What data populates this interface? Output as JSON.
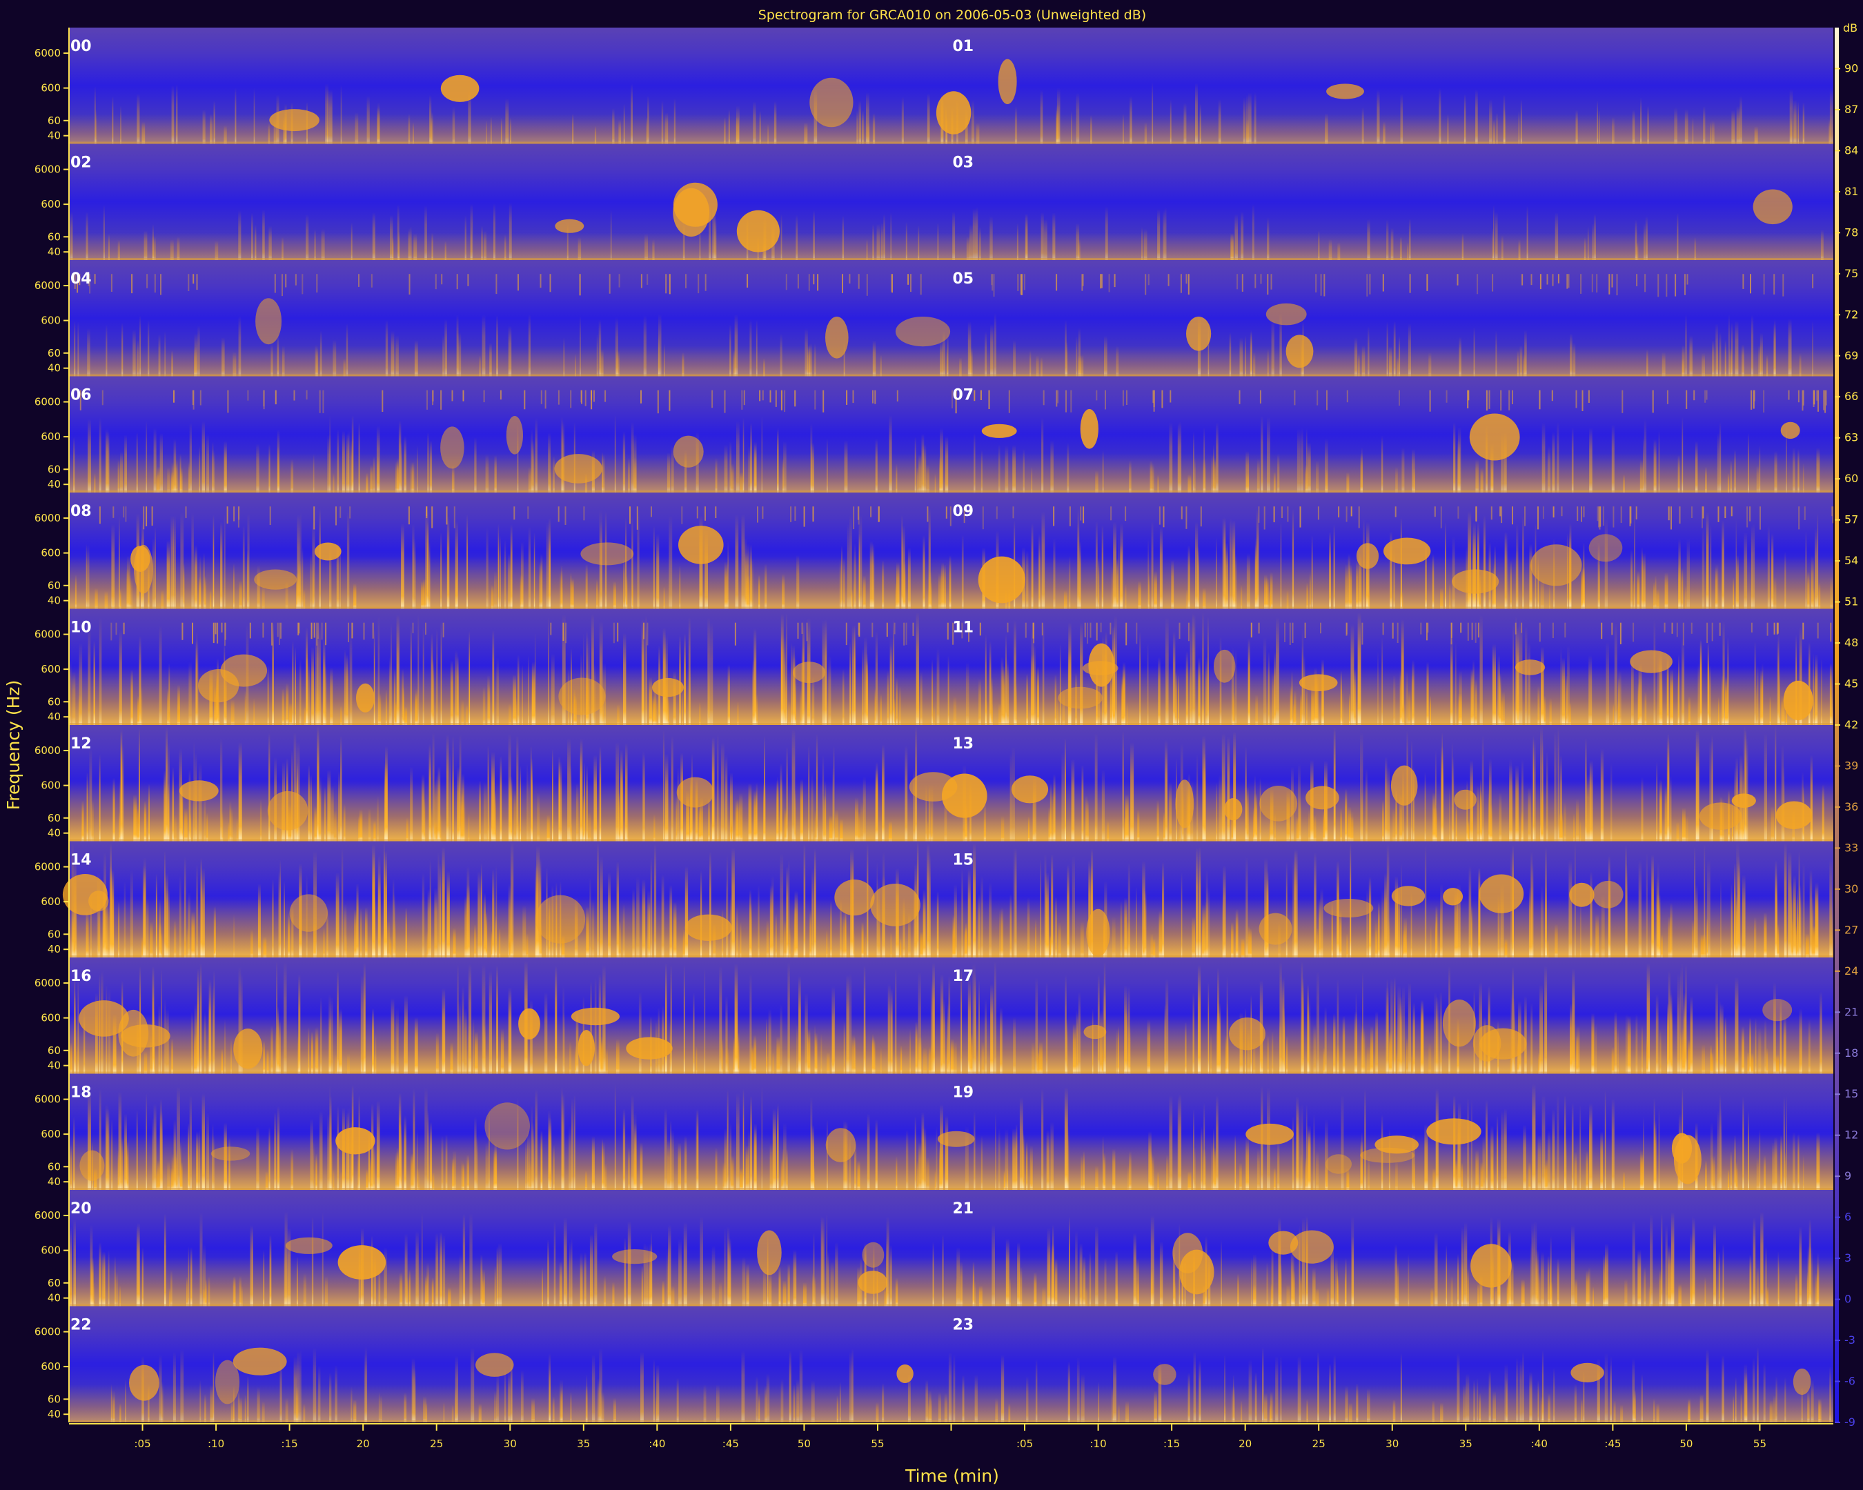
{
  "title": "Spectrogram for GRCA010 on 2006-05-03 (Unweighted dB)",
  "chart_data": {
    "type": "heatmap",
    "title": "Spectrogram for GRCA010 on 2006-05-03 (Unweighted dB)",
    "ylabel": "Frequency (Hz)",
    "xlabel": "Time (min)",
    "hours": [
      "00",
      "01",
      "02",
      "03",
      "04",
      "05",
      "06",
      "07",
      "08",
      "09",
      "10",
      "11",
      "12",
      "13",
      "14",
      "15",
      "16",
      "17",
      "18",
      "19",
      "20",
      "21",
      "22",
      "23"
    ],
    "y_ticks": [
      "6000",
      "600",
      "60",
      "40"
    ],
    "x_ticks": [
      ":05",
      ":10",
      ":15",
      "20",
      "25",
      "30",
      "35",
      ":40",
      ":45",
      "50",
      "55",
      ":05",
      ":10",
      ":15",
      "20",
      "25",
      "30",
      "35",
      ":40",
      ":45",
      "50",
      "55"
    ],
    "colorbar_unit": "dB",
    "colorbar_ticks": [
      "90",
      "87",
      "84",
      "81",
      "78",
      "75",
      "72",
      "69",
      "66",
      "63",
      "60",
      "57",
      "54",
      "51",
      "48",
      "45",
      "42",
      "39",
      "36",
      "33",
      "30",
      "27",
      "24",
      "21",
      "18",
      "15",
      "12",
      "9",
      "6",
      "3",
      "0",
      "-3",
      "-6",
      "-9"
    ],
    "colorbar_range": [
      -9,
      93
    ],
    "row_activity": [
      0.22,
      0.16,
      0.24,
      0.45,
      0.78,
      0.95,
      1.0,
      1.0,
      0.95,
      0.85,
      0.7,
      0.42
    ],
    "colors": {
      "background": "#0f0428",
      "low": "#2a1ed8",
      "mid": "#5a40b8",
      "high": "#f0a020",
      "peak": "#fff2c8",
      "axis": "#ffe34a"
    }
  }
}
